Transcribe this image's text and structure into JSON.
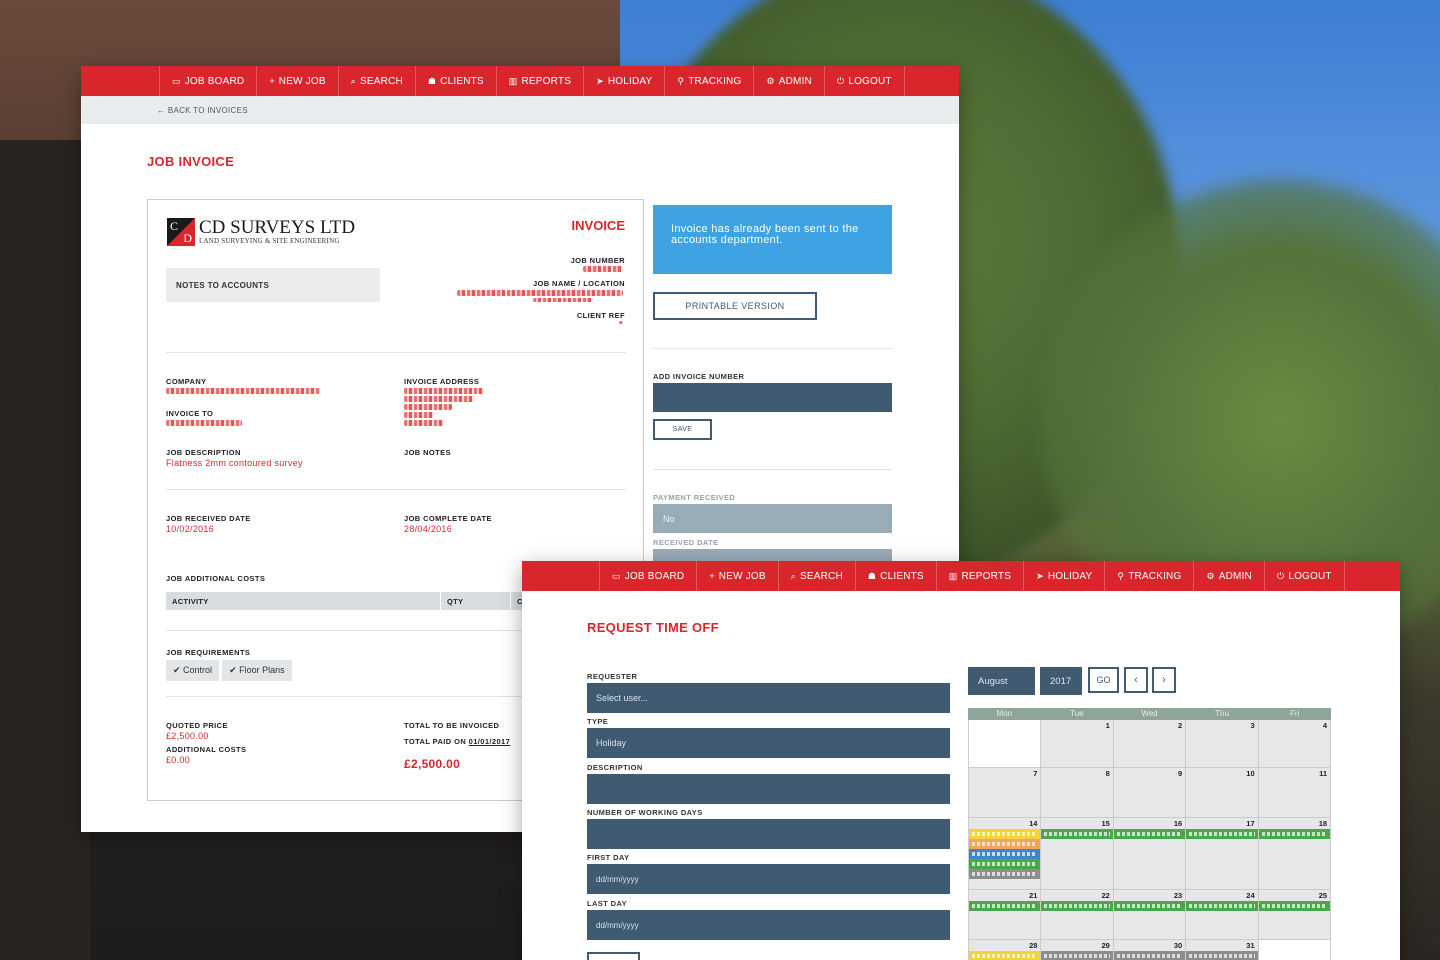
{
  "nav": {
    "items": [
      {
        "icon": "monitor-icon",
        "glyph": "▭",
        "label": "JOB BOARD"
      },
      {
        "icon": "plus-icon",
        "glyph": "+",
        "label": "NEW JOB"
      },
      {
        "icon": "search-icon",
        "glyph": "⌕",
        "label": "SEARCH"
      },
      {
        "icon": "users-icon",
        "glyph": "☗",
        "label": "CLIENTS"
      },
      {
        "icon": "bar-chart-icon",
        "glyph": "▥",
        "label": "REPORTS"
      },
      {
        "icon": "paper-plane-icon",
        "glyph": "➤",
        "label": "HOLIDAY"
      },
      {
        "icon": "map-pin-icon",
        "glyph": "⚲",
        "label": "TRACKING"
      },
      {
        "icon": "cogs-icon",
        "glyph": "⚙",
        "label": "ADMIN"
      },
      {
        "icon": "power-icon",
        "glyph": "⏻",
        "label": "LOGOUT"
      }
    ],
    "color": "#d9262d"
  },
  "invoice": {
    "back_link": "← BACK TO INVOICES",
    "page_title": "JOB INVOICE",
    "logo_name": "CD SURVEYS LTD",
    "logo_sub": "LAND SURVEYING & SITE ENGINEERING",
    "logo_c": "C",
    "logo_d": "D",
    "heading": "INVOICE",
    "notes_label": "NOTES TO ACCOUNTS",
    "job_number_label": "JOB NUMBER",
    "job_name_label": "JOB NAME / LOCATION",
    "client_ref_label": "CLIENT REF",
    "company_label": "COMPANY",
    "invoice_address_label": "INVOICE ADDRESS",
    "invoice_to_label": "INVOICE TO",
    "job_description_label": "JOB DESCRIPTION",
    "job_description": "Flatness 2mm contoured survey",
    "job_notes_label": "JOB NOTES",
    "received_date_label": "JOB RECEIVED DATE",
    "received_date": "10/02/2016",
    "complete_date_label": "JOB COMPLETE DATE",
    "complete_date": "28/04/2016",
    "additional_costs_label": "JOB ADDITIONAL COSTS",
    "table_headers": [
      "ACTIVITY",
      "QTY",
      "C"
    ],
    "requirements_label": "JOB REQUIREMENTS",
    "requirements": [
      "✔ Control",
      "✔ Floor Plans"
    ],
    "quoted_price_label": "QUOTED PRICE",
    "quoted_price": "£2,500.00",
    "additional_costs_total_label": "ADDITIONAL COSTS",
    "additional_costs_total": "£0.00",
    "total_invoiced_label": "TOTAL TO BE INVOICED",
    "total_paid_label": "TOTAL PAID ON",
    "total_paid_date": "01/01/2017",
    "total_amount": "£2,500.00",
    "info_message": "Invoice has already been sent to the accounts department.",
    "printable_button": "PRINTABLE VERSION",
    "add_invoice_number_label": "ADD INVOICE NUMBER",
    "save_button": "SAVE",
    "payment_received_label": "PAYMENT RECEIVED",
    "payment_received_value": "No",
    "received_date_side_label": "RECEIVED DATE"
  },
  "timeoff": {
    "page_title": "REQUEST TIME OFF",
    "requester_label": "REQUESTER",
    "requester_placeholder": "Select user...",
    "type_label": "TYPE",
    "type_value": "Holiday",
    "description_label": "DESCRIPTION",
    "working_days_label": "NUMBER OF WORKING DAYS",
    "first_day_label": "FIRST DAY",
    "first_day_placeholder": "dd/mm/yyyy",
    "last_day_label": "LAST DAY",
    "last_day_placeholder": "dd/mm/yyyy",
    "calendar": {
      "month": "August",
      "year": "2017",
      "go_button": "GO",
      "prev_glyph": "‹",
      "next_glyph": "›",
      "days": [
        "Mon",
        "Tue",
        "Wed",
        "Thu",
        "Fri"
      ],
      "weeks": [
        [
          "",
          "1",
          "2",
          "3",
          "4"
        ],
        [
          "7",
          "8",
          "9",
          "10",
          "11"
        ],
        [
          "14",
          "15",
          "16",
          "17",
          "18"
        ],
        [
          "21",
          "22",
          "23",
          "24",
          "25"
        ],
        [
          "28",
          "29",
          "30",
          "31",
          ""
        ]
      ],
      "event_colors": {
        "green": "#4aa84a",
        "yellow": "#f2d43a",
        "orange": "#f2a55a",
        "blue": "#3f86c9",
        "grey": "#8d8d8d"
      }
    }
  }
}
